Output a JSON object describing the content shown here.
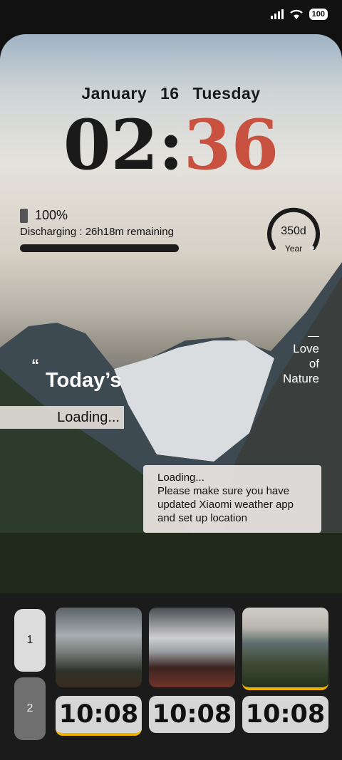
{
  "status_bar": {
    "battery": "100"
  },
  "lockscreen": {
    "date": {
      "month": "January",
      "day": "16",
      "weekday": "Tuesday"
    },
    "time": {
      "hour": "02",
      "sep": ":",
      "minute": "36"
    },
    "battery": {
      "percent": "100%",
      "status": "Discharging : 26h18m remaining"
    },
    "year_widget": {
      "value": "350d",
      "label": "Year",
      "progress": 0.96
    },
    "love": {
      "line1": "Love",
      "line2": "of",
      "line3": "Nature"
    },
    "quote": {
      "mark": "“",
      "title": "Today’s",
      "loading": "Loading..."
    },
    "weather_msg": {
      "line1": "Loading...",
      "line2": "Please make sure you have",
      "line3": "updated Xiaomi weather app",
      "line4": "and set up location"
    }
  },
  "dock": {
    "pages": [
      "1",
      "2"
    ],
    "clock_chips": [
      "10:08",
      "10:08",
      "10:08"
    ]
  },
  "colors": {
    "accent_minute": "#c8513f",
    "selection": "#f0b400"
  }
}
